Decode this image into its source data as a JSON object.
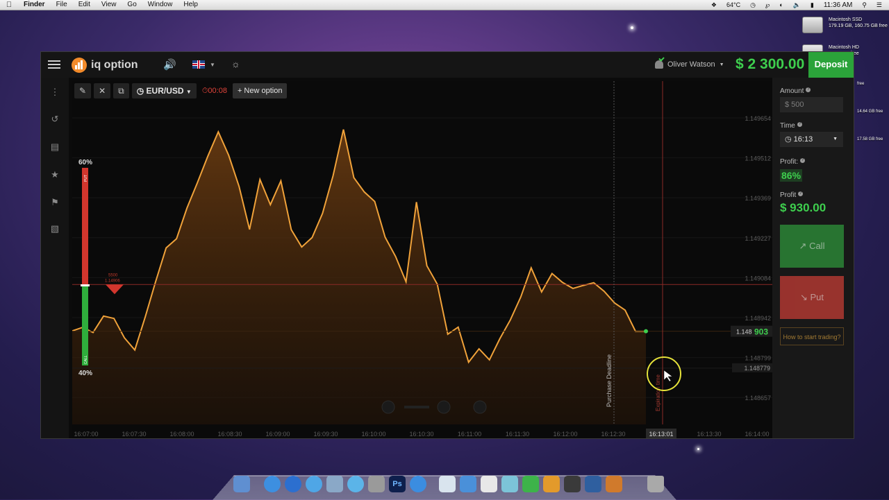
{
  "menubar": {
    "app": "Finder",
    "items": [
      "File",
      "Edit",
      "View",
      "Go",
      "Window",
      "Help"
    ],
    "temp": "64°C",
    "clock": "11:36 AM"
  },
  "desktop": {
    "drive1_name": "Macintosh SSD",
    "drive1_info": "179.19 GB, 160.75 GB free",
    "drive2_name": "Macintosh HD",
    "drive2_info": "37.66 GB free",
    "free3": "free",
    "free4": "14.64 GB free",
    "free5": "17.58 GB free"
  },
  "app": {
    "logo": "iq option",
    "user": "Oliver Watson",
    "balance": "$ 2 300.00",
    "deposit": "Deposit"
  },
  "toolbar": {
    "asset": "EUR/USD",
    "timer": "00:08",
    "new_option": "+ New option"
  },
  "right_panel": {
    "amount_label": "Amount",
    "amount_value": "$  500",
    "time_label": "Time",
    "time_value": "16:13",
    "profit_pct_label": "Profit:",
    "profit_pct": "86%",
    "profit_label": "Profit",
    "profit_value": "$ 930.00",
    "call": "Call",
    "put": "Put",
    "howto": "How to start trading?"
  },
  "chart_data": {
    "type": "area",
    "y_ticks": [
      "1.149654",
      "1.149512",
      "1.149369",
      "1.149227",
      "1.149084",
      "1.148942",
      "1.148799",
      "1.148657"
    ],
    "x_ticks": [
      "16:07:00",
      "16:07:30",
      "16:08:00",
      "16:08:30",
      "16:09:00",
      "16:09:30",
      "16:10:00",
      "16:10:30",
      "16:11:00",
      "16:11:30",
      "16:12:00",
      "16:12:30",
      "16:13:01",
      "16:13:30",
      "16:14:00"
    ],
    "current_price_prefix": "1.148",
    "current_price_suffix": "903",
    "line_price": "1.148779",
    "deal_amount": "5500",
    "deal_price": "1.14906",
    "put_pct": "60%",
    "call_pct": "40%",
    "put_label": "PUT",
    "call_label": "CALL",
    "purchase_deadline": "Purchase Deadline",
    "expiration_time": "Expiration time",
    "ylim": [
      1.14859,
      1.14972
    ],
    "prices": [
      1.148904,
      1.148916,
      1.148899,
      1.148954,
      1.148946,
      1.148881,
      1.14884,
      1.148951,
      1.14907,
      1.149183,
      1.149214,
      1.149317,
      1.149402,
      1.149491,
      1.149573,
      1.149494,
      1.149389,
      1.149245,
      1.149413,
      1.149328,
      1.149408,
      1.149244,
      1.149186,
      1.149218,
      1.149299,
      1.149425,
      1.149581,
      1.149419,
      1.149371,
      1.149339,
      1.149219,
      1.149154,
      1.149069,
      1.149337,
      1.149123,
      1.149061,
      1.148893,
      1.148917,
      1.148799,
      1.148844,
      1.148807,
      1.148878,
      1.148941,
      1.149018,
      1.149116,
      1.149035,
      1.149097,
      1.149067,
      1.149047,
      1.149057,
      1.149066,
      1.149037,
      1.148998,
      1.148974,
      1.148903,
      1.148903
    ]
  },
  "colors": {
    "accent_green": "#3ecf4e",
    "deposit_green": "#2ba33a",
    "put_red": "#b93a33",
    "line_orange": "#f0a23a",
    "timer_red": "#e0433a"
  }
}
